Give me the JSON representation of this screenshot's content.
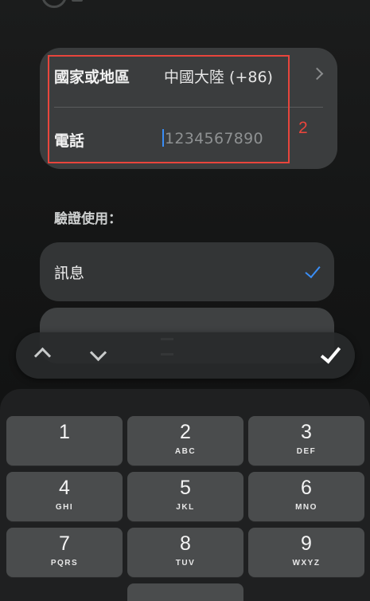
{
  "form": {
    "country_label": "國家或地區",
    "country_value": "中國大陸 (+86)",
    "phone_label": "電話",
    "phone_value": "1234567890"
  },
  "annotation": {
    "number": "2",
    "color": "#e8453c"
  },
  "verify": {
    "heading": "驗證使用：",
    "options": [
      {
        "label": "訊息",
        "selected": true
      }
    ]
  },
  "accessory_bar": {
    "prev_icon": "chevron-up-icon",
    "next_icon": "chevron-down-icon",
    "done_icon": "checkmark-icon"
  },
  "keypad": {
    "keys": [
      {
        "num": "1",
        "letters": ""
      },
      {
        "num": "2",
        "letters": "ABC"
      },
      {
        "num": "3",
        "letters": "DEF"
      },
      {
        "num": "4",
        "letters": "GHI"
      },
      {
        "num": "5",
        "letters": "JKL"
      },
      {
        "num": "6",
        "letters": "MNO"
      },
      {
        "num": "7",
        "letters": "PQRS"
      },
      {
        "num": "8",
        "letters": "TUV"
      },
      {
        "num": "9",
        "letters": "WXYZ"
      }
    ]
  },
  "colors": {
    "accent": "#3a8ef6",
    "key_bg": "#4a4c4d",
    "card_bg": "#3b3d3e"
  }
}
